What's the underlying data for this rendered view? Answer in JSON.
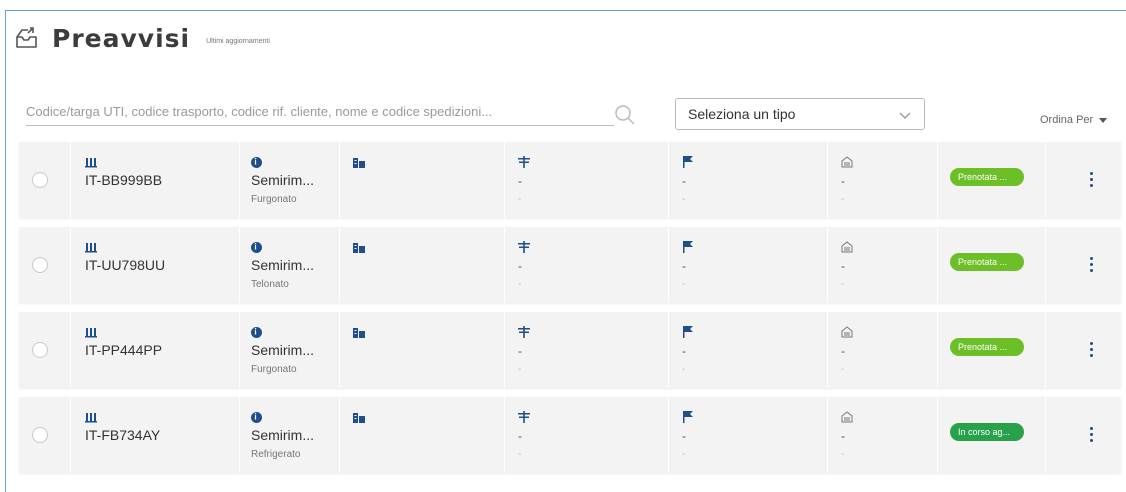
{
  "header": {
    "title": "Preavvisi",
    "subtitle": "Ultimi aggiornamenti"
  },
  "toolbar": {
    "search_placeholder": "Codice/targa UTI, codice trasporto, codice rif. cliente, nome e codice spedizioni...",
    "type_select_value": "Seleziona un tipo",
    "sort_label": "Ordina Per"
  },
  "rows": [
    {
      "plate": "IT-BB999BB",
      "type": "Semirim...",
      "subtype": "Furgonato",
      "transport_dash": "-",
      "transport_sub": "-",
      "flag_dash": "-",
      "flag_sub": "-",
      "doc_dash": "-",
      "doc_sub": "-",
      "status": "Prenotata ...",
      "status_color": "#6cbf26"
    },
    {
      "plate": "IT-UU798UU",
      "type": "Semirim...",
      "subtype": "Telonato",
      "transport_dash": "-",
      "transport_sub": "-",
      "flag_dash": "-",
      "flag_sub": "-",
      "doc_dash": "-",
      "doc_sub": "-",
      "status": "Prenotata ...",
      "status_color": "#6cbf26"
    },
    {
      "plate": "IT-PP444PP",
      "type": "Semirim...",
      "subtype": "Furgonato",
      "transport_dash": "-",
      "transport_sub": "-",
      "flag_dash": "-",
      "flag_sub": "-",
      "doc_dash": "-",
      "doc_sub": "-",
      "status": "Prenotata ...",
      "status_color": "#6cbf26"
    },
    {
      "plate": "IT-FB734AY",
      "type": "Semirim...",
      "subtype": "Refrigerato",
      "transport_dash": "-",
      "transport_sub": "-",
      "flag_dash": "-",
      "flag_sub": "-",
      "doc_dash": "-",
      "doc_sub": "-",
      "status": "In corso ag...",
      "status_color": "#27a14a"
    }
  ],
  "colors": {
    "accent": "#1f4e8c",
    "frame_border": "#5aa2d9",
    "row_bg": "#f3f3f3"
  },
  "icons": [
    "page-inbox-icon",
    "search-icon",
    "chevron-down-icon",
    "vehicle-icon",
    "info-icon",
    "warehouse-icon",
    "transport-icon",
    "flag-icon",
    "document-icon",
    "kebab-menu-icon"
  ]
}
